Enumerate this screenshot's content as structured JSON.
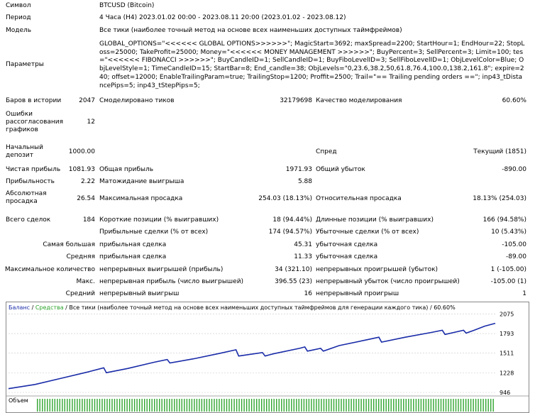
{
  "report": {
    "symbol": {
      "label": "Символ",
      "value": "BTCUSD (Bitcoin)"
    },
    "period": {
      "label": "Период",
      "value": "4 Часа (H4) 2023.01.02 00:00 - 2023.08.11 20:00 (2023.01.02 - 2023.08.12)"
    },
    "model": {
      "label": "Модель",
      "value": "Все тики (наиболее точный метод на основе всех наименьших доступных таймфреймов)"
    },
    "parameters": {
      "label": "Параметры",
      "value": "GLOBAL_OPTIONS=\"<<<<<< GLOBAL OPTIONS>>>>>>\"; MagicStart=3692; maxSpread=2200; StartHour=1; EndHour=22; StopLoss=25000; TakeProfit=25000; Money=\"<<<<<< MONEY MANAGEMENT >>>>>>\"; BuyPercent=3; SellPercent=3; Limit=100; tes=\"<<<<<< FIBONACCI >>>>>>\"; BuyCandleID=1; SellCandleID=1; BuyFiboLevelID=3; SellFiboLevelID=1; ObjLevelColor=Blue; ObjLevelStyle=1; TimeCandleID=15; StartBar=8; End_candle=38; ObjLevels=\"0,23.6,38.2,50,61.8,76.4,100.0,138.2,161.8\"; expire=240; offset=12000; EnableTrailingParam=true; TrailingStop=1200; Proffit=2500; Trail=\"== Trailing pending orders ==\"; inp43_tDistancePips=5; inp43_tStepPips=5;"
    },
    "bars": {
      "label": "Баров в истории",
      "value": "2047"
    },
    "ticks": {
      "label": "Смоделировано тиков",
      "value": "32179698"
    },
    "quality": {
      "label": "Качество моделирования",
      "value": "60.60%"
    },
    "errors": {
      "label": "Ошибки рассогласования графиков",
      "value": "12"
    },
    "deposit": {
      "label": "Начальный депозит",
      "value": "1000.00"
    },
    "spread": {
      "label": "Спред",
      "value": "Текущий (1851)"
    },
    "net_profit": {
      "label": "Чистая прибыль",
      "value": "1081.93"
    },
    "gross_profit": {
      "label": "Общая прибыль",
      "value": "1971.93"
    },
    "gross_loss": {
      "label": "Общий убыток",
      "value": "-890.00"
    },
    "profit_factor": {
      "label": "Прибыльность",
      "value": "2.22"
    },
    "expected_payoff": {
      "label": "Матожидание выигрыша",
      "value": "5.88"
    },
    "abs_drawdown": {
      "label": "Абсолютная просадка",
      "value": "26.54"
    },
    "max_drawdown": {
      "label": "Максимальная просадка",
      "value": "254.03 (18.13%)"
    },
    "rel_drawdown": {
      "label": "Относительная просадка",
      "value": "18.13% (254.03)"
    },
    "total_trades": {
      "label": "Всего сделок",
      "value": "184"
    },
    "short_pos": {
      "label": "Короткие позиции (% выигравших)",
      "value": "18 (94.44%)"
    },
    "long_pos": {
      "label": "Длинные позиции (% выигравших)",
      "value": "166 (94.58%)"
    },
    "profit_trades": {
      "label": "Прибыльные сделки (% от всех)",
      "value": "174 (94.57%)"
    },
    "loss_trades": {
      "label": "Убыточные сделки (% от всех)",
      "value": "10 (5.43%)"
    },
    "largest": {
      "label": "Самая большая",
      "profit_label": "прибыльная сделка",
      "profit": "45.31",
      "loss_label": "убыточная сделка",
      "loss": "-105.00"
    },
    "average": {
      "label": "Средняя",
      "profit_label": "прибыльная сделка",
      "profit": "11.33",
      "loss_label": "убыточная сделка",
      "loss": "-89.00"
    },
    "max_consec": {
      "label": "Максимальное количество",
      "wins_label": "непрерывных выигрышей (прибыль)",
      "wins": "34 (321.10)",
      "losses_label": "непрерывных проигрышей (убыток)",
      "losses": "1 (-105.00)"
    },
    "max_consec_money": {
      "label": "Макс.",
      "wins_label": "непрерывная прибыль (число выигрышей)",
      "wins": "396.55 (23)",
      "losses_label": "непрерывный убыток (число проигрышей)",
      "losses": "-105.00 (1)"
    },
    "avg_consec": {
      "label": "Средний",
      "wins_label": "непрерывный выигрыш",
      "wins": "16",
      "losses_label": "непрерывный проигрыш",
      "losses": "1"
    }
  },
  "chart_data": {
    "type": "line",
    "legend": {
      "balance": "Баланс",
      "separator1": " / ",
      "equity": "Средства",
      "separator2": " / ",
      "model": "Все тики (наиболее точный метод на основе всех наименьших доступных таймфреймов для генерации каждого тика)",
      "separator3": " / ",
      "quality": "60.60%"
    },
    "volume_label": "Объем",
    "y_ticks": [
      "2075",
      "1793",
      "1511",
      "1228",
      "946"
    ],
    "ylim": [
      946,
      2110
    ],
    "trades": 184,
    "colors": {
      "balance": "#1a2ca8",
      "equity": "#29a329",
      "volume": "#2fa52f",
      "grid": "#c8c8c8"
    },
    "series": [
      {
        "x": [
          0,
          10,
          20,
          30,
          36,
          37,
          45,
          55,
          60,
          61,
          70,
          80,
          86,
          87,
          96,
          97,
          100,
          110,
          112,
          113,
          118,
          119,
          125,
          135,
          140,
          141,
          150,
          160,
          164,
          165,
          172,
          173,
          176,
          180,
          184
        ],
        "values": [
          1000,
          1060,
          1150,
          1240,
          1300,
          1230,
          1290,
          1380,
          1420,
          1370,
          1430,
          1510,
          1560,
          1470,
          1520,
          1470,
          1500,
          1580,
          1600,
          1540,
          1580,
          1540,
          1620,
          1700,
          1740,
          1670,
          1740,
          1810,
          1840,
          1780,
          1840,
          1800,
          1840,
          1900,
          1940
        ]
      }
    ]
  }
}
